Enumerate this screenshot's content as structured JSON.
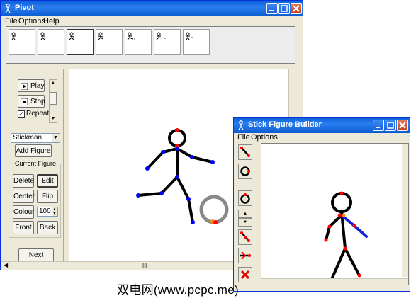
{
  "main_window": {
    "title": "Pivot",
    "menu": [
      "File",
      "Options",
      "Help"
    ],
    "frame_count": 7,
    "controls": {
      "play_label": "Play",
      "stop_label": "Stop",
      "repeat_label": "Repeat",
      "repeat_checked": true,
      "figure_type": "Stickman",
      "add_figure_label": "Add Figure",
      "current_figure_label": "Current Figure",
      "delete_label": "Delete",
      "edit_label": "Edit",
      "center_label": "Center",
      "flip_label": "Flip",
      "colour_label": "Colour",
      "colour_value": "100",
      "front_label": "Front",
      "back_label": "Back",
      "next_frame_label": "Next Frame"
    }
  },
  "builder_window": {
    "title": "Stick Figure Builder",
    "menu": [
      "File",
      "Options"
    ],
    "tools": [
      "line-tool-icon",
      "circle-tool-icon",
      "hollow-circle-tool-icon",
      "scroll-up-icon",
      "scroll-down-icon",
      "duplicate-segment-icon",
      "split-segment-icon",
      "delete-tool-icon"
    ]
  },
  "watermark": "双电网(www.pcpc.me)",
  "colors": {
    "titlebar": "#0a5fd8",
    "joint_blue": "#0000ff",
    "joint_red": "#ff0000",
    "joint_orange": "#ff8800",
    "ball_gray": "#888888"
  }
}
